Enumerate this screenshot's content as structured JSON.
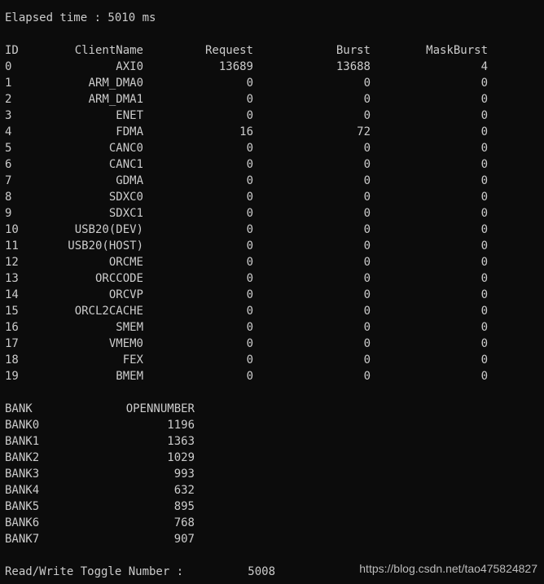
{
  "console": {
    "elapsed_label": "Elapsed time : 5010 ms",
    "client_table": {
      "headers": {
        "id": "ID",
        "client": "ClientName",
        "request": "Request",
        "burst": "Burst",
        "maskburst": "MaskBurst"
      },
      "rows": [
        {
          "id": "0",
          "client": "AXI0",
          "request": "13689",
          "burst": "13688",
          "maskburst": "4"
        },
        {
          "id": "1",
          "client": "ARM_DMA0",
          "request": "0",
          "burst": "0",
          "maskburst": "0"
        },
        {
          "id": "2",
          "client": "ARM_DMA1",
          "request": "0",
          "burst": "0",
          "maskburst": "0"
        },
        {
          "id": "3",
          "client": "ENET",
          "request": "0",
          "burst": "0",
          "maskburst": "0"
        },
        {
          "id": "4",
          "client": "FDMA",
          "request": "16",
          "burst": "72",
          "maskburst": "0"
        },
        {
          "id": "5",
          "client": "CANC0",
          "request": "0",
          "burst": "0",
          "maskburst": "0"
        },
        {
          "id": "6",
          "client": "CANC1",
          "request": "0",
          "burst": "0",
          "maskburst": "0"
        },
        {
          "id": "7",
          "client": "GDMA",
          "request": "0",
          "burst": "0",
          "maskburst": "0"
        },
        {
          "id": "8",
          "client": "SDXC0",
          "request": "0",
          "burst": "0",
          "maskburst": "0"
        },
        {
          "id": "9",
          "client": "SDXC1",
          "request": "0",
          "burst": "0",
          "maskburst": "0"
        },
        {
          "id": "10",
          "client": "USB20(DEV)",
          "request": "0",
          "burst": "0",
          "maskburst": "0"
        },
        {
          "id": "11",
          "client": "USB20(HOST)",
          "request": "0",
          "burst": "0",
          "maskburst": "0"
        },
        {
          "id": "12",
          "client": "ORCME",
          "request": "0",
          "burst": "0",
          "maskburst": "0"
        },
        {
          "id": "13",
          "client": "ORCCODE",
          "request": "0",
          "burst": "0",
          "maskburst": "0"
        },
        {
          "id": "14",
          "client": "ORCVP",
          "request": "0",
          "burst": "0",
          "maskburst": "0"
        },
        {
          "id": "15",
          "client": "ORCL2CACHE",
          "request": "0",
          "burst": "0",
          "maskburst": "0"
        },
        {
          "id": "16",
          "client": "SMEM",
          "request": "0",
          "burst": "0",
          "maskburst": "0"
        },
        {
          "id": "17",
          "client": "VMEM0",
          "request": "0",
          "burst": "0",
          "maskburst": "0"
        },
        {
          "id": "18",
          "client": "FEX",
          "request": "0",
          "burst": "0",
          "maskburst": "0"
        },
        {
          "id": "19",
          "client": "BMEM",
          "request": "0",
          "burst": "0",
          "maskburst": "0"
        }
      ]
    },
    "bank_table": {
      "headers": {
        "bank": "BANK",
        "open": "OPENNUMBER"
      },
      "rows": [
        {
          "bank": "BANK0",
          "open": "1196"
        },
        {
          "bank": "BANK1",
          "open": "1363"
        },
        {
          "bank": "BANK2",
          "open": "1029"
        },
        {
          "bank": "BANK3",
          "open": "993"
        },
        {
          "bank": "BANK4",
          "open": "632"
        },
        {
          "bank": "BANK5",
          "open": "895"
        },
        {
          "bank": "BANK6",
          "open": "768"
        },
        {
          "bank": "BANK7",
          "open": "907"
        }
      ]
    },
    "toggle": {
      "label": "Read/Write Toggle Number :",
      "value": "5008"
    }
  },
  "watermark": "https://blog.csdn.net/tao475824827"
}
